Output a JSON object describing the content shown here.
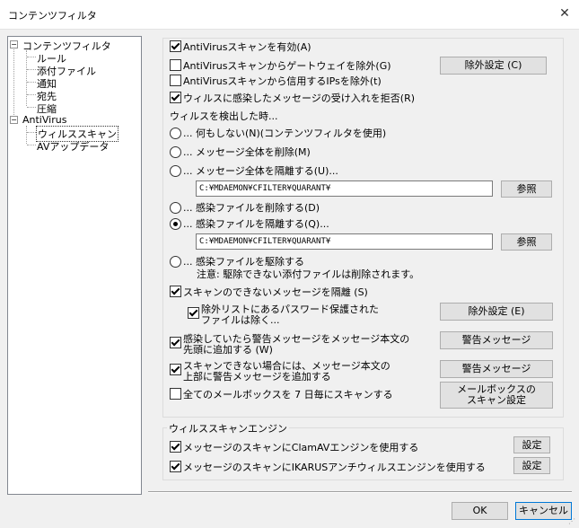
{
  "window": {
    "title": "コンテンツフィルタ"
  },
  "tree": {
    "root1": "コンテンツフィルタ",
    "root1_children": [
      "ルール",
      "添付ファイル",
      "通知",
      "宛先",
      "圧縮"
    ],
    "root2": "AntiVirus",
    "root2_children": [
      "ウィルススキャン",
      "AVアップデータ"
    ]
  },
  "antivirus": {
    "enable": {
      "label": "AntiVirusスキャンを有効(A)",
      "checked": true
    },
    "exclude_gateway": {
      "label": "AntiVirusスキャンからゲートウェイを除外(G)",
      "checked": false
    },
    "exclude_ips": {
      "label": "AntiVirusスキャンから信用するIPsを除外(t)",
      "checked": false
    },
    "reject_infected": {
      "label": "ウィルスに感染したメッセージの受け入れを拒否(R)",
      "checked": true
    },
    "exclusion_button": "除外設定 (C)",
    "on_detect_heading": "ウィルスを検出した時...",
    "options": [
      {
        "label": "... 何もしない(N)(コンテンツフィルタを使用)",
        "checked": false
      },
      {
        "label": "... メッセージ全体を削除(M)",
        "checked": false
      },
      {
        "label": "... メッセージ全体を隔離する(U)...",
        "checked": false
      },
      {
        "label": "... 感染ファイルを削除する(D)",
        "checked": false
      },
      {
        "label": "... 感染ファイルを隔離する(Q)...",
        "checked": true
      },
      {
        "label": "... 感染ファイルを駆除する",
        "checked": false
      }
    ],
    "quarantine_path_1": "C:¥MDAEMON¥CFILTER¥QUARANT¥",
    "quarantine_path_2": "C:¥MDAEMON¥CFILTER¥QUARANT¥",
    "browse_label": "参照",
    "clean_note": "注意: 駆除できない添付ファイルは削除されます。",
    "quarantine_unscannable": {
      "label": "スキャンのできないメッセージを隔離 (S)",
      "checked": true
    },
    "exclude_password": {
      "label_line1": "除外リストにあるパスワード保護された",
      "label_line2": "ファイルは除く...",
      "checked": true
    },
    "exclusion_button_e": "除外設定 (E)",
    "add_warning": {
      "label_line1": "感染していたら警告メッセージをメッセージ本文の",
      "label_line2": "先頭に追加する (W)",
      "checked": true
    },
    "warning_button": "警告メッセージ",
    "unscannable_warning": {
      "label_line1": "スキャンできない場合には、メッセージ本文の",
      "label_line2": "上部に警告メッセージを追加する",
      "checked": true
    },
    "scan_all_mailboxes": {
      "label": "全てのメールボックスを 7 日毎にスキャンする",
      "checked": false
    },
    "mailbox_scan_button_line1": "メールボックスの",
    "mailbox_scan_button_line2": "スキャン設定"
  },
  "engines": {
    "title": "ウィルススキャンエンジン",
    "clamav": {
      "label": "メッセージのスキャンにClamAVエンジンを使用する",
      "checked": true
    },
    "ikarus": {
      "label": "メッセージのスキャンにIKARUSアンチウィルスエンジンを使用する",
      "checked": true
    },
    "settings_label": "設定"
  },
  "footer": {
    "ok": "OK",
    "cancel": "キャンセル"
  }
}
